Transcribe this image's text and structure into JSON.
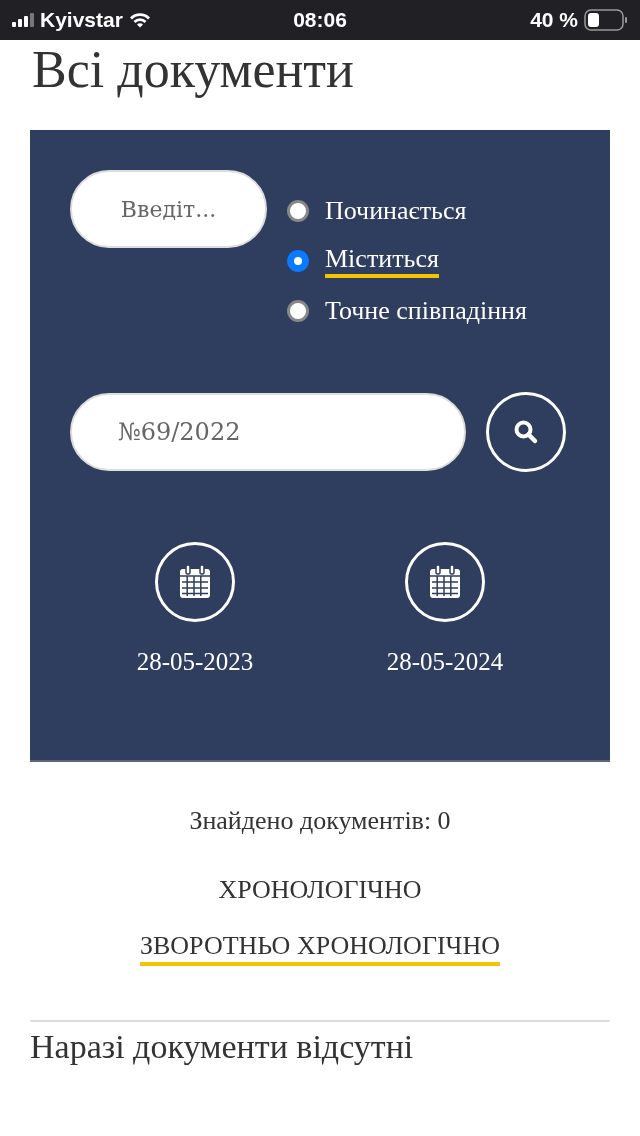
{
  "status_bar": {
    "carrier": "Kyivstar",
    "time": "08:06",
    "battery": "40 %"
  },
  "title": "Всі документи",
  "filter": {
    "text_field": {
      "placeholder": "Введіт..."
    },
    "match_options": [
      {
        "label": "Починається",
        "selected": false
      },
      {
        "label": "Міститься",
        "selected": true
      },
      {
        "label": "Точне співпадіння",
        "selected": false
      }
    ],
    "number_field": {
      "value": "№69/2022"
    },
    "dates": [
      {
        "value": "28-05-2023"
      },
      {
        "value": "28-05-2024"
      }
    ]
  },
  "found_count": "Знайдено документів: 0",
  "sort_options": [
    {
      "label": "ХРОНОЛОГІЧНО",
      "selected": false
    },
    {
      "label": "ЗВОРОТНЬО ХРОНОЛОГІЧНО",
      "selected": true
    }
  ],
  "empty_message": "Наразі документи відсутні"
}
